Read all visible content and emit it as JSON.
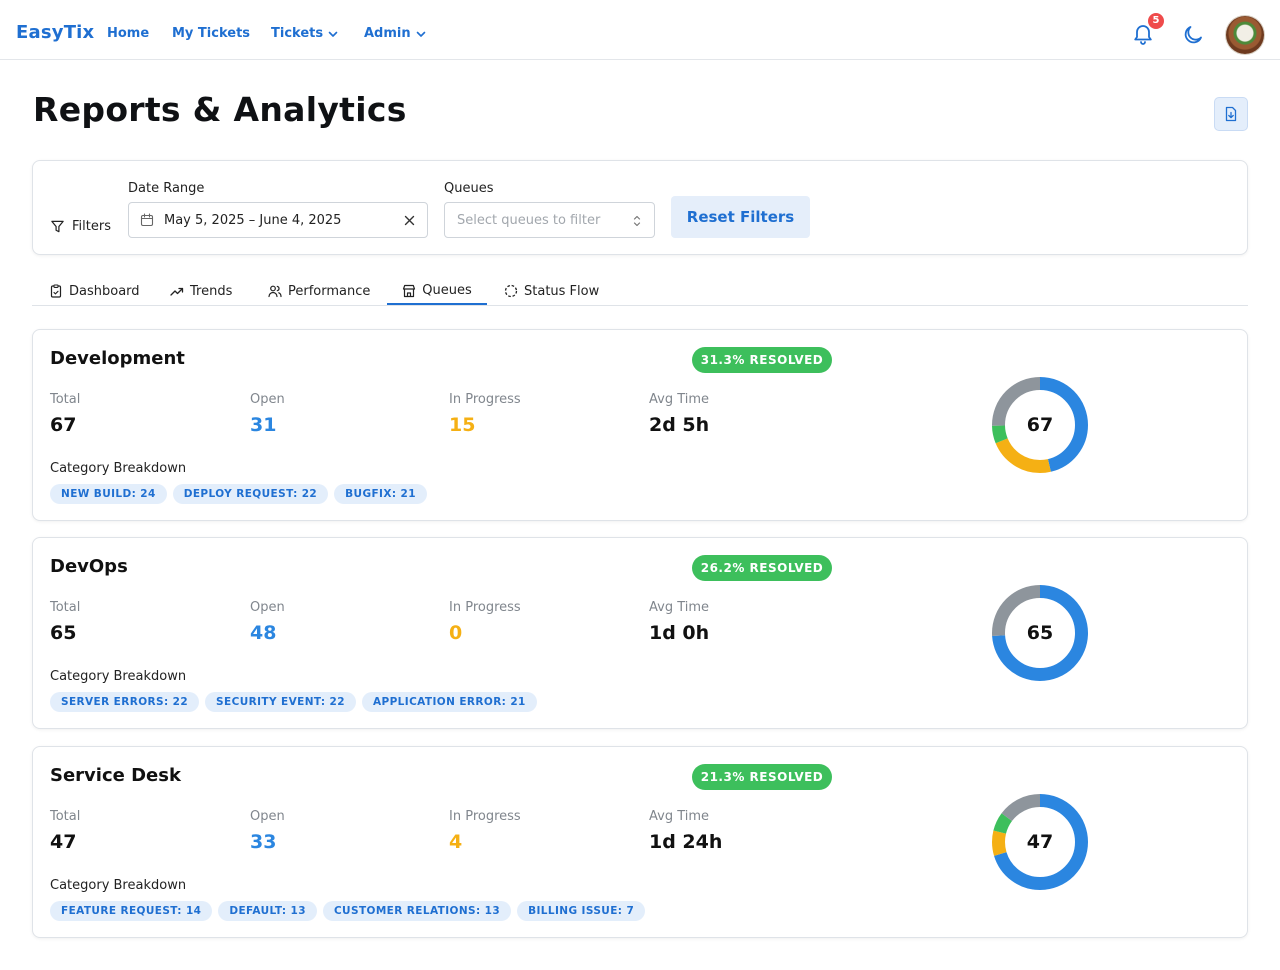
{
  "header": {
    "brand": "EasyTix",
    "nav": [
      {
        "label": "Home"
      },
      {
        "label": "My Tickets"
      },
      {
        "label": "Tickets",
        "has_dropdown": true
      },
      {
        "label": "Admin",
        "has_dropdown": true
      }
    ],
    "notification_count": "5",
    "icons": [
      "bell-icon",
      "moon-icon",
      "avatar"
    ]
  },
  "page": {
    "title": "Reports & Analytics",
    "export_icon": "file-download-icon"
  },
  "filters": {
    "label": "Filters",
    "date_range_label": "Date Range",
    "date_range_value": "May 5, 2025 – June 4, 2025",
    "queues_label": "Queues",
    "queues_placeholder": "Select queues to filter",
    "reset_label": "Reset Filters"
  },
  "tabs": [
    {
      "label": "Dashboard",
      "icon": "clipboard-icon",
      "active": false
    },
    {
      "label": "Trends",
      "icon": "trending-up-icon",
      "active": false
    },
    {
      "label": "Performance",
      "icon": "users-icon",
      "active": false
    },
    {
      "label": "Queues",
      "icon": "store-icon",
      "active": true
    },
    {
      "label": "Status Flow",
      "icon": "dashed-circle-icon",
      "active": false
    }
  ],
  "stat_labels": {
    "total": "Total",
    "open": "Open",
    "in_progress": "In Progress",
    "avg_time": "Avg Time",
    "category_breakdown": "Category Breakdown"
  },
  "colors": {
    "open": "#2b86e0",
    "in_progress": "#f5b014",
    "resolved": "#3dbf5c",
    "other": "#8e959c",
    "accent": "#1f6fd1"
  },
  "queues": [
    {
      "name": "Development",
      "resolved_badge": "31.3% RESOLVED",
      "total": "67",
      "open": "31",
      "in_progress": "15",
      "avg_time": "2d 5h",
      "categories": [
        "NEW BUILD: 24",
        "DEPLOY REQUEST: 22",
        "BUGFIX: 21"
      ],
      "donut": {
        "open": 31,
        "in_progress": 15,
        "resolved": 4,
        "other": 17
      }
    },
    {
      "name": "DevOps",
      "resolved_badge": "26.2% RESOLVED",
      "total": "65",
      "open": "48",
      "in_progress": "0",
      "avg_time": "1d 0h",
      "categories": [
        "SERVER ERRORS: 22",
        "SECURITY EVENT: 22",
        "APPLICATION ERROR: 21"
      ],
      "donut": {
        "open": 48,
        "in_progress": 0,
        "resolved": 0,
        "other": 17
      }
    },
    {
      "name": "Service Desk",
      "resolved_badge": "21.3% RESOLVED",
      "total": "47",
      "open": "33",
      "in_progress": "4",
      "avg_time": "1d 24h",
      "categories": [
        "FEATURE REQUEST: 14",
        "DEFAULT: 13",
        "CUSTOMER RELATIONS: 13",
        "BILLING ISSUE: 7"
      ],
      "donut": {
        "open": 33,
        "in_progress": 4,
        "resolved": 3,
        "other": 7
      }
    }
  ]
}
